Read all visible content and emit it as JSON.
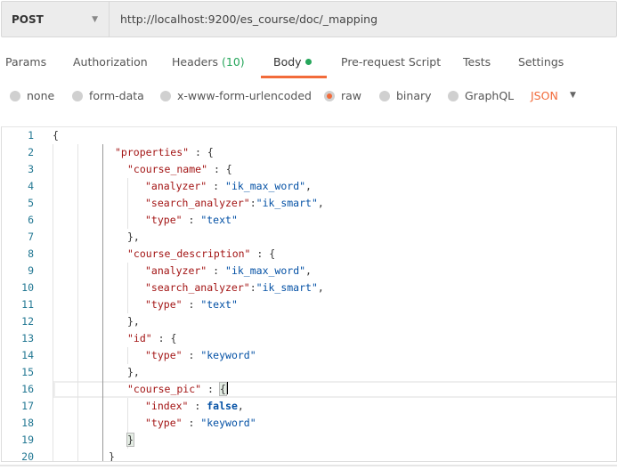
{
  "request": {
    "method": "POST",
    "url": "http://localhost:9200/es_course/doc/_mapping"
  },
  "tabs": [
    {
      "label": "Params"
    },
    {
      "label": "Authorization"
    },
    {
      "label": "Headers",
      "count": "(10)"
    },
    {
      "label": "Body",
      "active": true
    },
    {
      "label": "Pre-request Script"
    },
    {
      "label": "Tests"
    },
    {
      "label": "Settings"
    }
  ],
  "body_types": [
    {
      "label": "none"
    },
    {
      "label": "form-data"
    },
    {
      "label": "x-www-form-urlencoded"
    },
    {
      "label": "raw",
      "selected": true
    },
    {
      "label": "binary"
    },
    {
      "label": "GraphQL"
    }
  ],
  "format": "JSON",
  "colors": {
    "accent": "#f26b3a",
    "green": "#26a65b",
    "key": "#a31515",
    "string": "#0451a5"
  },
  "editor": {
    "lines": [
      [
        [
          "p",
          "{"
        ]
      ],
      [
        [
          "k",
          "\"properties\""
        ],
        [
          "p",
          " : {"
        ]
      ],
      [
        [
          "k",
          "\"course_name\""
        ],
        [
          "p",
          " : {"
        ]
      ],
      [
        [
          "k",
          "\"analyzer\""
        ],
        [
          "p",
          " : "
        ],
        [
          "s",
          "\"ik_max_word\""
        ],
        [
          "p",
          ","
        ]
      ],
      [
        [
          "k",
          "\"search_analyzer\""
        ],
        [
          "p",
          ":"
        ],
        [
          "s",
          "\"ik_smart\""
        ],
        [
          "p",
          ","
        ]
      ],
      [
        [
          "k",
          "\"type\""
        ],
        [
          "p",
          " : "
        ],
        [
          "s",
          "\"text\""
        ]
      ],
      [
        [
          "p",
          "},"
        ]
      ],
      [
        [
          "k",
          "\"course_description\""
        ],
        [
          "p",
          " : {"
        ]
      ],
      [
        [
          "k",
          "\"analyzer\""
        ],
        [
          "p",
          " : "
        ],
        [
          "s",
          "\"ik_max_word\""
        ],
        [
          "p",
          ","
        ]
      ],
      [
        [
          "k",
          "\"search_analyzer\""
        ],
        [
          "p",
          ":"
        ],
        [
          "s",
          "\"ik_smart\""
        ],
        [
          "p",
          ","
        ]
      ],
      [
        [
          "k",
          "\"type\""
        ],
        [
          "p",
          " : "
        ],
        [
          "s",
          "\"text\""
        ]
      ],
      [
        [
          "p",
          "},"
        ]
      ],
      [
        [
          "k",
          "\"id\""
        ],
        [
          "p",
          " : {"
        ]
      ],
      [
        [
          "k",
          "\"type\""
        ],
        [
          "p",
          " : "
        ],
        [
          "s",
          "\"keyword\""
        ]
      ],
      [
        [
          "p",
          "},"
        ]
      ],
      [
        [
          "k",
          "\"course_pic\""
        ],
        [
          "p",
          " : "
        ],
        [
          "bm",
          "{"
        ]
      ],
      [
        [
          "k",
          "\"index\""
        ],
        [
          "p",
          " : "
        ],
        [
          "b",
          "false"
        ],
        [
          "p",
          ","
        ]
      ],
      [
        [
          "k",
          "\"type\""
        ],
        [
          "p",
          " : "
        ],
        [
          "s",
          "\"keyword\""
        ]
      ],
      [
        [
          "bm",
          "}"
        ]
      ],
      [
        [
          "p",
          "}"
        ]
      ]
    ]
  }
}
